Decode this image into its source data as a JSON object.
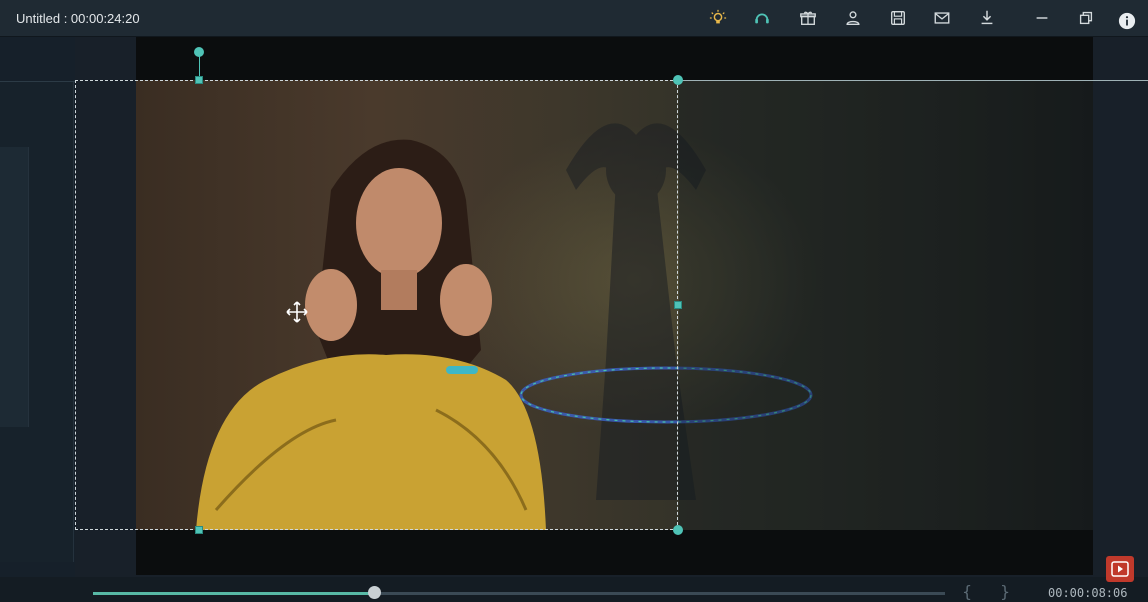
{
  "titlebar": {
    "title": "Untitled : 00:00:24:20",
    "icons": [
      "bulb-icon",
      "headset-icon",
      "gift-icon",
      "account-icon",
      "save-icon",
      "mail-icon",
      "download-icon",
      "minimize-icon",
      "restore-icon",
      "info-icon"
    ]
  },
  "preview": {
    "progress_percent": 33,
    "mark_in": "{",
    "mark_out": "}",
    "timecode": "00:00:08:06"
  },
  "colors": {
    "accent": "#4fc3b6",
    "titlebar": "#1f2a33",
    "background": "#1b252e"
  }
}
